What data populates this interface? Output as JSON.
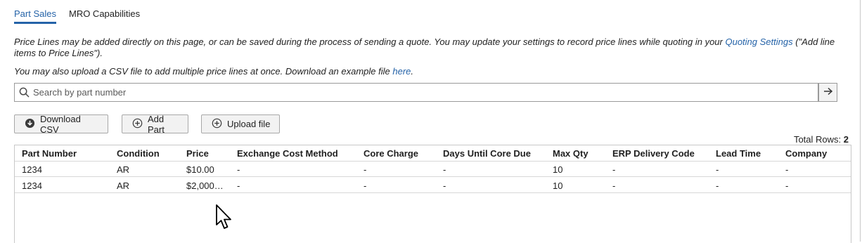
{
  "tabs": [
    {
      "label": "Part Sales",
      "active": true
    },
    {
      "label": "MRO Capabilities",
      "active": false
    }
  ],
  "intro": {
    "text_before": "Price Lines may be added directly on this page, or can be saved during the process of sending a quote. You may update your settings to record price lines while quoting in your ",
    "link": "Quoting Settings",
    "text_after": " (\"Add line items to Price Lines\")."
  },
  "csv_note": {
    "text_before": "You may also upload a CSV file to add multiple price lines at once. Download an example file ",
    "link": "here",
    "text_after": "."
  },
  "search": {
    "placeholder": "Search by part number",
    "value": ""
  },
  "buttons": {
    "download": "Download CSV",
    "add": "Add Part",
    "upload": "Upload file"
  },
  "total_rows": {
    "label": "Total Rows:",
    "value": "2"
  },
  "table": {
    "columns": [
      "Part Number",
      "Condition",
      "Price",
      "Exchange Cost Method",
      "Core Charge",
      "Days Until Core Due",
      "Max Qty",
      "ERP Delivery Code",
      "Lead Time",
      "Company"
    ],
    "rows": [
      [
        "1234",
        "AR",
        "$10.00",
        "-",
        "-",
        "-",
        "10",
        "-",
        "-",
        "-"
      ],
      [
        "1234",
        "AR",
        "$2,000…",
        "-",
        "-",
        "-",
        "10",
        "-",
        "-",
        "-"
      ]
    ]
  },
  "colors": {
    "accent": "#2563a8",
    "border": "#c8c8c8",
    "button_bg": "#f2f2f2"
  }
}
